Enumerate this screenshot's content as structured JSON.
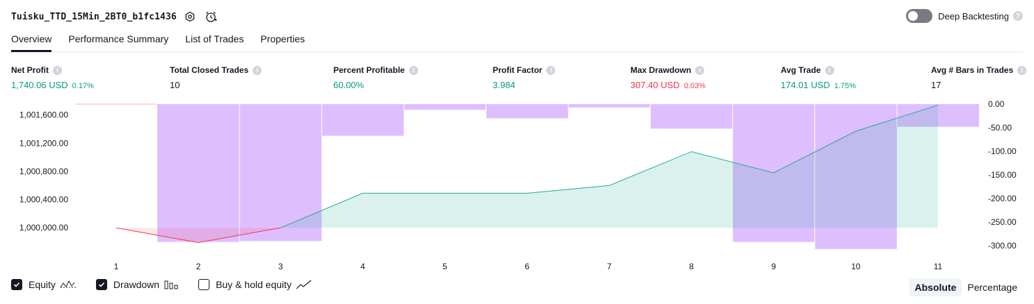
{
  "header": {
    "strategy_name": "Tuisku_TTD_15Min_2BT0_b1fc1436",
    "settings_icon": "settings-icon",
    "alert_icon": "add-alert-icon",
    "deep_backtesting_label": "Deep Backtesting",
    "deep_backtesting_on": false
  },
  "tabs": [
    {
      "label": "Overview",
      "active": true
    },
    {
      "label": "Performance Summary",
      "active": false
    },
    {
      "label": "List of Trades",
      "active": false
    },
    {
      "label": "Properties",
      "active": false
    }
  ],
  "metrics": [
    {
      "label": "Net Profit",
      "value": "1,740.06 USD",
      "pct": "0.17%",
      "color": "#089981"
    },
    {
      "label": "Total Closed Trades",
      "value": "10",
      "pct": "",
      "color": "#131722"
    },
    {
      "label": "Percent Profitable",
      "value": "60.00%",
      "pct": "",
      "color": "#089981"
    },
    {
      "label": "Profit Factor",
      "value": "3.984",
      "pct": "",
      "color": "#089981"
    },
    {
      "label": "Max Drawdown",
      "value": "307.40 USD",
      "pct": "0.03%",
      "color": "#f23645"
    },
    {
      "label": "Avg Trade",
      "value": "174.01 USD",
      "pct": "1.75%",
      "color": "#089981"
    },
    {
      "label": "Avg # Bars in Trades",
      "value": "17",
      "pct": "",
      "color": "#131722"
    }
  ],
  "chart_data": {
    "type": "line",
    "x": [
      1,
      2,
      3,
      4,
      5,
      6,
      7,
      8,
      9,
      10,
      11
    ],
    "series": [
      {
        "name": "Equity",
        "axis": "left",
        "values": [
          1000000,
          999790,
          1000000,
          1000490,
          1000490,
          1000490,
          1000600,
          1001080,
          1000780,
          1001370,
          1001740
        ]
      },
      {
        "name": "Drawdown",
        "axis": "right",
        "type": "bar",
        "values": [
          0,
          -292,
          -290,
          -67,
          -12,
          -30,
          -7,
          -52,
          -292,
          -307,
          -48
        ]
      }
    ],
    "left_ticks": [
      "1,001,600.00",
      "1,001,200.00",
      "1,000,800.00",
      "1,000,400.00",
      "1,000,000.00"
    ],
    "left_tick_values": [
      1001600,
      1001200,
      1000800,
      1000400,
      1000000
    ],
    "right_ticks": [
      "0.00",
      "-50.00",
      "-100.00",
      "-150.00",
      "-200.00",
      "-250.00",
      "-300.00"
    ],
    "right_tick_values": [
      0,
      -50,
      -100,
      -150,
      -200,
      -250,
      -300
    ],
    "x_ticks": [
      "1",
      "2",
      "3",
      "4",
      "5",
      "6",
      "7",
      "8",
      "9",
      "10",
      "11"
    ],
    "equity_color": "#22ab94",
    "equity_negative_color": "#f23645",
    "drawdown_color": "#d9b3ff"
  },
  "legend": [
    {
      "label": "Equity",
      "checked": true,
      "icon": "equity-line-icon"
    },
    {
      "label": "Drawdown",
      "checked": true,
      "icon": "drawdown-bars-icon"
    },
    {
      "label": "Buy & hold equity",
      "checked": false,
      "icon": "buy-hold-line-icon"
    }
  ],
  "mode": {
    "absolute_label": "Absolute",
    "percentage_label": "Percentage",
    "selected": "Absolute"
  }
}
